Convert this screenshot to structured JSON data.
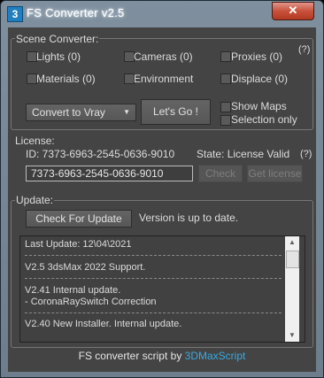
{
  "window": {
    "title": "FS Converter v2.5",
    "icon_glyph": "3",
    "close_glyph": "✕"
  },
  "scene_converter": {
    "group_label": "Scene Converter:",
    "help": "(?)",
    "checkboxes": [
      {
        "label": "Lights (0)",
        "checked": false
      },
      {
        "label": "Cameras (0)",
        "checked": false
      },
      {
        "label": "Proxies (0)",
        "checked": false
      },
      {
        "label": "Materials (0)",
        "checked": false
      },
      {
        "label": "Environment",
        "checked": false
      },
      {
        "label": "Displace (0)",
        "checked": false
      },
      {
        "label": "Show Maps",
        "checked": false
      },
      {
        "label": "Selection only",
        "checked": false
      }
    ],
    "convert_dropdown": {
      "value": "Convert to Vray",
      "icon": "dropdown-arrow-icon"
    },
    "lets_go_label": "Let's Go !"
  },
  "license": {
    "group_label": "License:",
    "id_text": "ID: 7373-6963-2545-0636-9010",
    "state_text": "State: License Valid",
    "help": "(?)",
    "key_value": "7373-6963-2545-0636-9010",
    "check_label": "Check",
    "get_license_label": "Get license"
  },
  "update": {
    "group_label": "Update:",
    "check_button_label": "Check For Update",
    "status_text": "Version is up to date.",
    "log_lines": [
      "Last Update: 12\\04\\2021",
      "V2.5 3dsMax 2022 Support.",
      "V2.41 Internal update.",
      "- CoronaRaySwitch Correction",
      "V2.40 New Installer. Internal update."
    ]
  },
  "footer": {
    "prefix": "FS converter script by ",
    "link_text": "3DMaxScript"
  },
  "colors": {
    "panel_bg": "#444444",
    "text": "#dcdcdc",
    "link": "#3aa8e0",
    "close_button": "#c8513c"
  }
}
